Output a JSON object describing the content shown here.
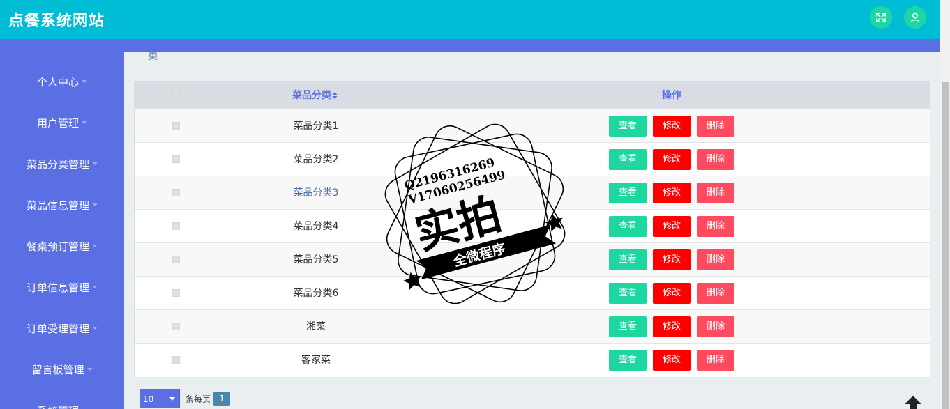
{
  "app": {
    "title": "点餐系统网站"
  },
  "sidebar": {
    "items": [
      {
        "label": "个人中心"
      },
      {
        "label": "用户管理"
      },
      {
        "label": "菜品分类管理"
      },
      {
        "label": "菜品信息管理"
      },
      {
        "label": "餐桌预订管理"
      },
      {
        "label": "订单信息管理"
      },
      {
        "label": "订单受理管理"
      },
      {
        "label": "留言板管理"
      },
      {
        "label": "系统管理"
      }
    ]
  },
  "breadcrumb": {
    "fragment": "类"
  },
  "table": {
    "columns": {
      "name": "菜品分类",
      "actions": "操作"
    },
    "sort_icon": "sort-icon",
    "rows": [
      {
        "name": "菜品分类1"
      },
      {
        "name": "菜品分类2"
      },
      {
        "name": "菜品分类3"
      },
      {
        "name": "菜品分类4"
      },
      {
        "name": "菜品分类5"
      },
      {
        "name": "菜品分类6"
      },
      {
        "name": "湘菜"
      },
      {
        "name": "客家菜"
      }
    ],
    "actions": {
      "view": "查看",
      "edit": "修改",
      "delete": "删除"
    }
  },
  "pagination": {
    "per_page": "10",
    "per_page_label": "条每页",
    "current_page": "1"
  },
  "watermark": {
    "line1": "Q2196316269",
    "line2": "V17060256499",
    "main": "实拍",
    "sub": "全微程序"
  },
  "colors": {
    "header": "#00bcd4",
    "sidebar": "#5a6fe4",
    "view": "#1ed6a0",
    "edit": "#ff0000",
    "delete": "#ff4a5f"
  }
}
